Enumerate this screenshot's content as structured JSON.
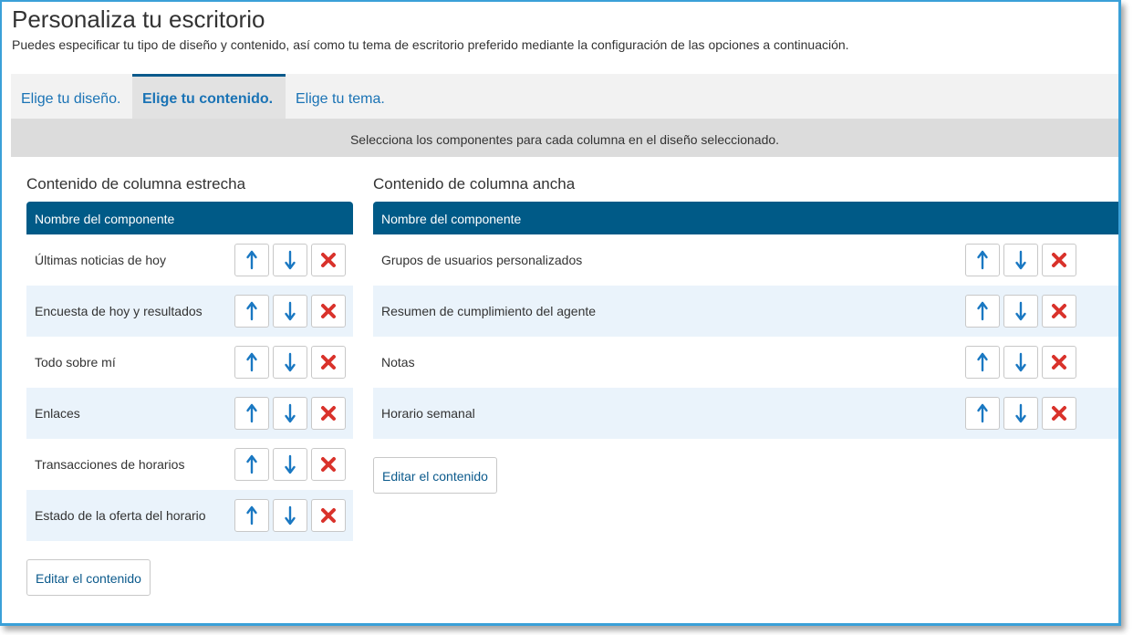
{
  "header": {
    "title": "Personaliza tu escritorio",
    "description": "Puedes especificar tu tipo de diseño y contenido, así como tu tema de escritorio preferido mediante la configuración de las opciones a continuación."
  },
  "tabs": [
    {
      "label": "Elige tu diseño.",
      "active": false
    },
    {
      "label": "Elige tu contenido.",
      "active": true
    },
    {
      "label": "Elige tu tema.",
      "active": false
    }
  ],
  "instruction": "Selecciona los componentes para cada columna en el diseño seleccionado.",
  "narrow_column": {
    "title": "Contenido de columna estrecha",
    "header": "Nombre del componente",
    "rows": [
      {
        "label": "Últimas noticias de hoy"
      },
      {
        "label": "Encuesta de hoy y resultados"
      },
      {
        "label": "Todo sobre mí"
      },
      {
        "label": "Enlaces"
      },
      {
        "label": "Transacciones de horarios"
      },
      {
        "label": "Estado de la oferta del horario"
      }
    ],
    "edit_label": "Editar el contenido"
  },
  "wide_column": {
    "title": "Contenido de columna ancha",
    "header": "Nombre del componente",
    "rows": [
      {
        "label": "Grupos de usuarios personalizados"
      },
      {
        "label": "Resumen de cumplimiento del agente"
      },
      {
        "label": "Notas"
      },
      {
        "label": "Horario semanal"
      }
    ],
    "edit_label": "Editar el contenido"
  },
  "row_actions": [
    {
      "icon": "arrow-up-icon",
      "action": "move-up"
    },
    {
      "icon": "arrow-down-icon",
      "action": "move-down"
    },
    {
      "icon": "delete-x-icon",
      "action": "remove"
    }
  ],
  "colors": {
    "accent": "#005a87",
    "link": "#1a73b5",
    "delete": "#d9322b",
    "arrow": "#1a78c2",
    "alt_row": "#eaf3fb",
    "frame_border": "#3aa0d8"
  }
}
